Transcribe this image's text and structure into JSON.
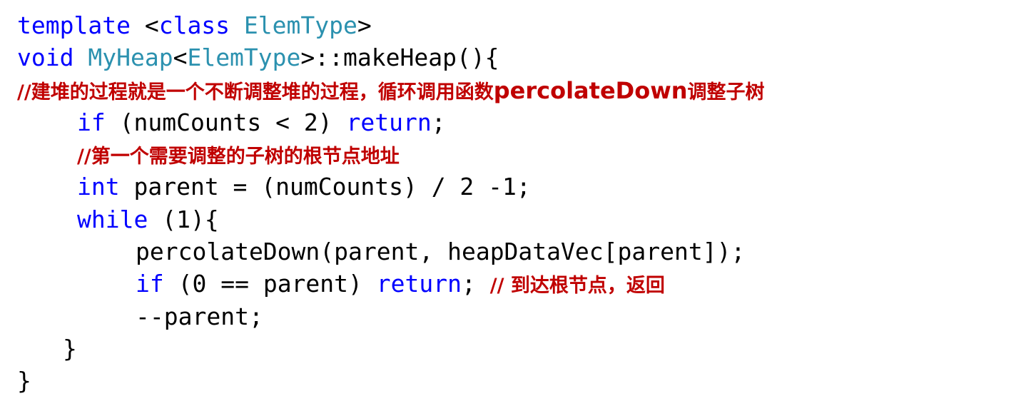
{
  "code": {
    "l1": {
      "kw_template": "template",
      "lt": " <",
      "kw_class": "class",
      "sp": " ",
      "type_elem": "ElemType",
      "gt": ">"
    },
    "l2": {
      "kw_void": "void",
      "sp": " ",
      "type_heap": "MyHeap",
      "lt": "<",
      "type_elem": "ElemType",
      "rest": ">::makeHeap(){"
    },
    "l3": {
      "comment_a": "//建堆的过程就是一个不断调整堆的过程，循环调用函数",
      "comment_latin": "percolateDown",
      "comment_b": "调整子树"
    },
    "l4": {
      "kw_if": "if",
      "rest": " (numCounts < 2) ",
      "kw_return": "return",
      "semi": ";"
    },
    "l5": {
      "comment": "//第一个需要调整的子树的根节点地址"
    },
    "l6": {
      "kw_int": "int",
      "rest": " parent = (numCounts) / 2 -1;"
    },
    "l7": {
      "kw_while": "while",
      "rest": " (1){"
    },
    "l8": {
      "text": "percolateDown(parent, heapDataVec[parent]);"
    },
    "l9": {
      "kw_if": "if",
      "rest": " (0 == parent) ",
      "kw_return": "return",
      "semi": "; ",
      "comment": "// 到达根节点，返回"
    },
    "l10": {
      "text": "--parent;"
    },
    "l11": {
      "text": "}"
    },
    "l12": {
      "text": "}"
    }
  },
  "colors": {
    "keyword": "#0000ff",
    "type": "#2b91af",
    "comment": "#c00000",
    "text": "#000000"
  }
}
